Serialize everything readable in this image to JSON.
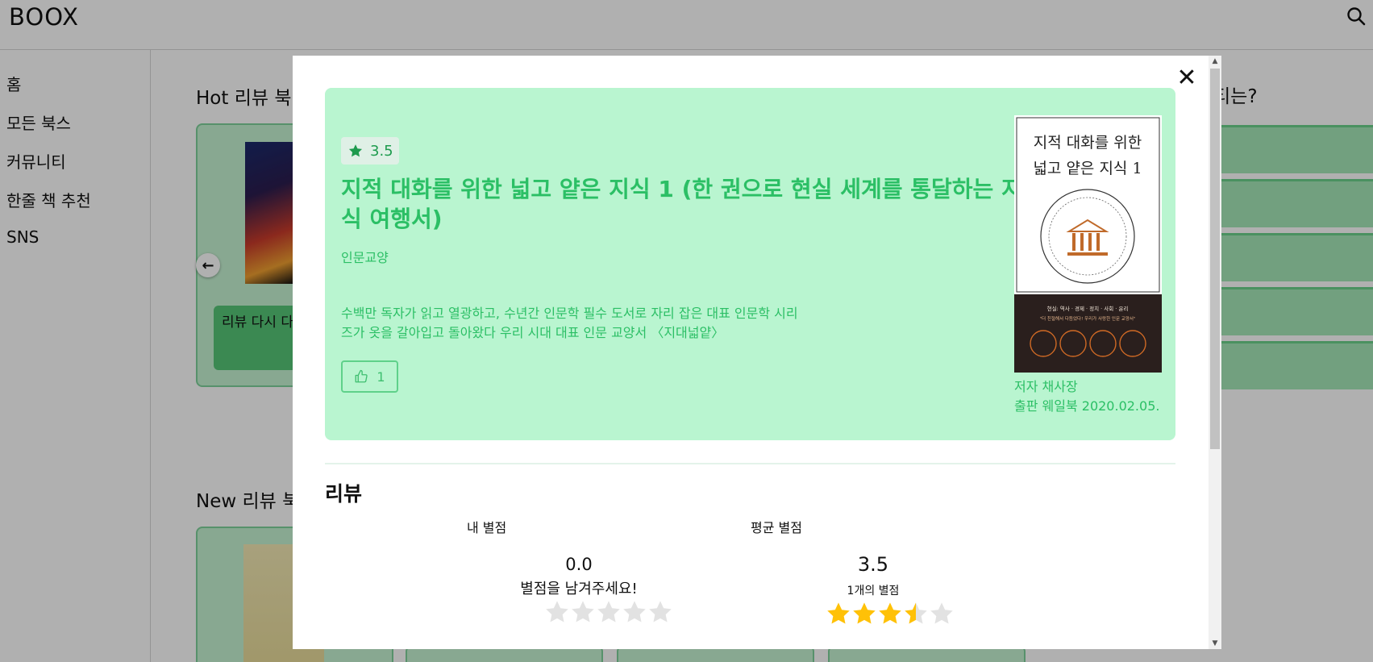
{
  "app": {
    "logo": "BOOX",
    "search_icon": "search-icon"
  },
  "sidebar": {
    "items": [
      {
        "label": "홈"
      },
      {
        "label": "모든 북스"
      },
      {
        "label": "커뮤니티"
      },
      {
        "label": "한줄 책 추천"
      },
      {
        "label": "SNS"
      }
    ]
  },
  "background": {
    "hot_title": "Hot 리뷰 북",
    "new_title": "New 리뷰 북",
    "right_title": "티는?",
    "review_card_text": "리뷰 다시 다",
    "prev_arrow": "←"
  },
  "modal": {
    "close_label": "✕",
    "book": {
      "rating": "3.5",
      "title": "지적 대화를 위한 넓고 얕은 지식 1 (한 권으로 현실 세계를 통달하는 지식 여행서)",
      "category": "인문교양",
      "description": "수백만 독자가 읽고 열광하고, 수년간 인문학 필수 도서로 자리 잡은 대표 인문학 시리즈가 옷을 갈아입고 돌아왔다 우리 시대 대표 인문 교양서 〈지대넓얕〉",
      "likes": "1",
      "author": "저자 채사장",
      "publisher": "출판 웨일북 2020.02.05.",
      "cover": {
        "title_line1": "지적 대화를 위한",
        "title_line2": "넓고 얕은 지식 1",
        "bottom_line1": "현실: 역사 · 경제 · 정치 · 사회 · 윤리",
        "bottom_line2": "\"더 친절해서 다듬었다! 우리가 사랑한 인문 교양서\""
      }
    },
    "review": {
      "title": "리뷰",
      "my_label": "내 별점",
      "avg_label": "평균 별점",
      "my_value": "0.0",
      "my_prompt": "별점을 남겨주세요!",
      "my_rating": 0,
      "avg_value": "3.5",
      "avg_count": "1개의 별점",
      "avg_rating": 3.5
    }
  },
  "colors": {
    "accent": "#2bbf65",
    "panel": "#b9f5d0",
    "star_fill": "#ffc107",
    "star_empty": "#e2e2e2"
  }
}
